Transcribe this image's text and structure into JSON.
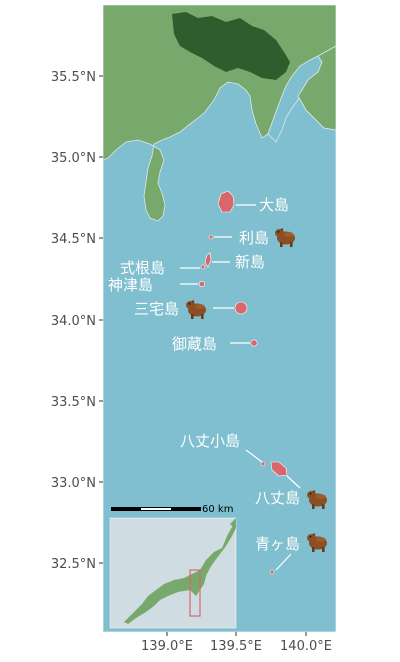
{
  "map": {
    "colors": {
      "sea": "#7fbfcf",
      "land": "#78a96c",
      "tokyo": "#2e5e2e",
      "island_fill": "#d9666b",
      "coast": "#dfe7ea",
      "inset_sea": "#cfdde2",
      "inset_land": "#78a96c",
      "inset_box": "#d9666b",
      "label_text": "#ffffff"
    },
    "y_axis_labels": [
      "35.5°N",
      "35.0°N",
      "34.5°N",
      "34.0°N",
      "33.5°N",
      "33.0°N",
      "32.5°N"
    ],
    "x_axis_labels": [
      "139.0°E",
      "139.5°E",
      "140.0°E"
    ],
    "scale_bar": {
      "label": "60 km"
    },
    "islands": [
      {
        "name": "大島",
        "capybara": false
      },
      {
        "name": "利島",
        "capybara": true
      },
      {
        "name": "新島",
        "capybara": false
      },
      {
        "name": "式根島",
        "capybara": false
      },
      {
        "name": "神津島",
        "capybara": false
      },
      {
        "name": "三宅島",
        "capybara": true
      },
      {
        "name": "御蔵島",
        "capybara": false
      },
      {
        "name": "八丈小島",
        "capybara": false
      },
      {
        "name": "八丈島",
        "capybara": true
      },
      {
        "name": "青ヶ島",
        "capybara": true
      }
    ],
    "icons": {
      "capybara": "capybara-icon"
    }
  }
}
